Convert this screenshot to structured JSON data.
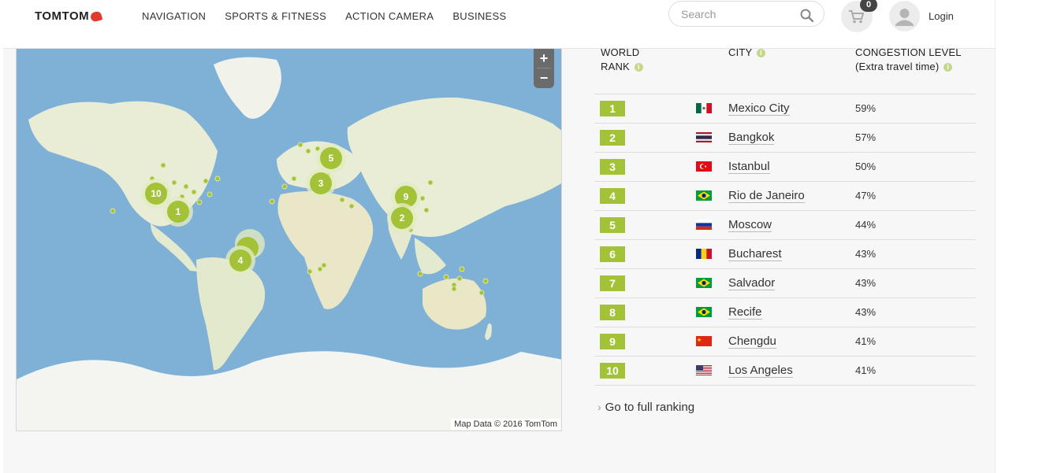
{
  "header": {
    "logo": "TOMTOM",
    "nav": [
      "NAVIGATION",
      "SPORTS & FITNESS",
      "ACTION CAMERA",
      "BUSINESS"
    ],
    "search_placeholder": "Search",
    "cart_count": "0",
    "login": "Login"
  },
  "map": {
    "zoom_in": "+",
    "zoom_out": "−",
    "attribution": "Map Data © 2016 TomTom",
    "cluster_labels": [
      "5",
      "3",
      "10",
      "1",
      "9",
      "2",
      "4"
    ]
  },
  "table": {
    "col_rank": "WORLD RANK",
    "col_city": "CITY",
    "col_level": "CONGESTION LEVEL (Extra travel time)",
    "rows": [
      {
        "rank": "1",
        "city": "Mexico City",
        "level": "59%",
        "flag": "mexico"
      },
      {
        "rank": "2",
        "city": "Bangkok",
        "level": "57%",
        "flag": "thailand"
      },
      {
        "rank": "3",
        "city": "Istanbul",
        "level": "50%",
        "flag": "turkey"
      },
      {
        "rank": "4",
        "city": "Rio de Janeiro",
        "level": "47%",
        "flag": "brazil"
      },
      {
        "rank": "5",
        "city": "Moscow",
        "level": "44%",
        "flag": "russia"
      },
      {
        "rank": "6",
        "city": "Bucharest",
        "level": "43%",
        "flag": "romania"
      },
      {
        "rank": "7",
        "city": "Salvador",
        "level": "43%",
        "flag": "brazil"
      },
      {
        "rank": "8",
        "city": "Recife",
        "level": "43%",
        "flag": "brazil"
      },
      {
        "rank": "9",
        "city": "Chengdu",
        "level": "41%",
        "flag": "china"
      },
      {
        "rank": "10",
        "city": "Los Angeles",
        "level": "41%",
        "flag": "usa"
      }
    ]
  },
  "full_ranking": "Go to full ranking",
  "colors": {
    "accent": "#a3c238",
    "ocean": "#7fb0d6",
    "land": "#e9edd6",
    "ice": "#f4f4f0"
  }
}
